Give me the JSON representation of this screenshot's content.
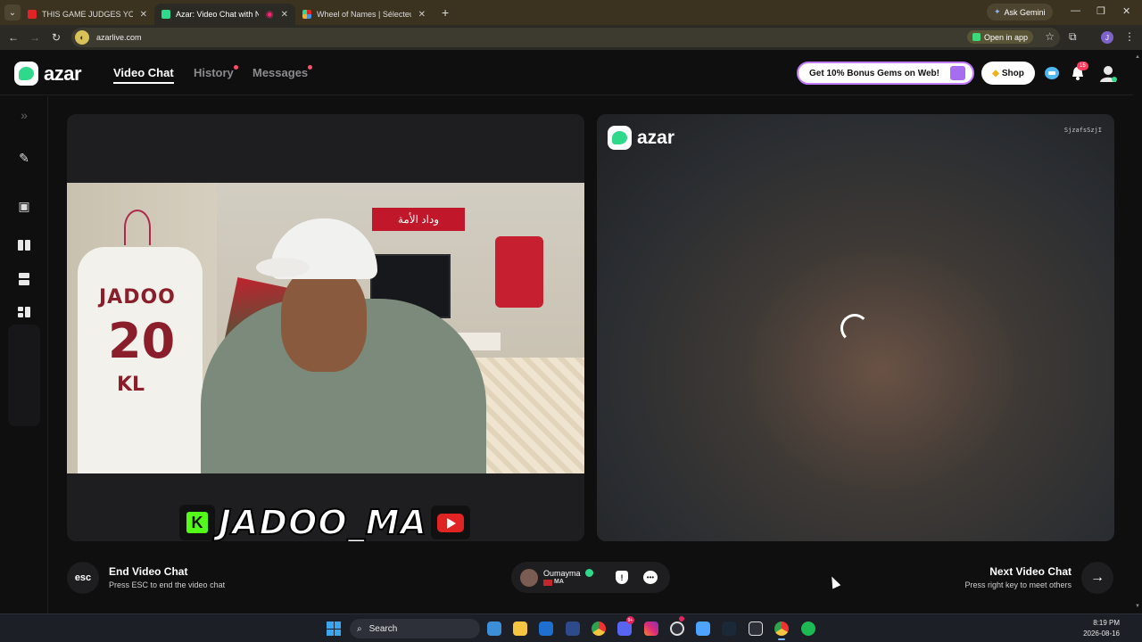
{
  "browser": {
    "tabs": [
      {
        "title": "THIS GAME JUDGES YOUR VOICE",
        "favicon_color": "#e02424",
        "active": false
      },
      {
        "title": "Azar: Video Chat with New",
        "favicon_color": "#2fd88a",
        "active": true
      },
      {
        "title": "Wheel of Names | Sélecteur de",
        "favicon_color": "#4a90e2",
        "active": false
      }
    ],
    "ask_gemini": "Ask Gemini",
    "url": "azarlive.com",
    "open_in_app": "Open in app"
  },
  "app": {
    "logo_text": "azar",
    "nav": [
      {
        "label": "Video Chat",
        "active": true,
        "has_dot": false
      },
      {
        "label": "History",
        "active": false,
        "has_dot": true
      },
      {
        "label": "Messages",
        "active": false,
        "has_dot": true
      }
    ],
    "promo": "Get 10% Bonus Gems on Web!",
    "shop": "Shop",
    "notification_count": "15",
    "accent_color": "#2fd88a"
  },
  "rail": {
    "icons": [
      "expand-icon",
      "magic-wand-icon",
      "sticker-icon",
      "layout-side-by-side-icon",
      "layout-stacked-icon",
      "layout-grid-icon"
    ]
  },
  "local_video": {
    "shirt_name": "JADOO",
    "shirt_number": "20",
    "shirt_initials": "KL",
    "banner_text": "وداد الأمة",
    "watermark": "JADOO_MA",
    "kick_letter": "K"
  },
  "remote_video": {
    "logo_text": "azar",
    "session_id": "SjzafsSzjI"
  },
  "controls": {
    "esc_label": "esc",
    "end_title": "End Video Chat",
    "end_subtitle": "Press ESC to end the video chat",
    "partner_name": "Oumayma",
    "partner_country": "MA",
    "next_title": "Next Video Chat",
    "next_subtitle": "Press right key to meet others"
  },
  "taskbar": {
    "search_label": "Search",
    "time": "8:19 PM",
    "date": "2026-08-16",
    "discord_badge": "9+"
  }
}
